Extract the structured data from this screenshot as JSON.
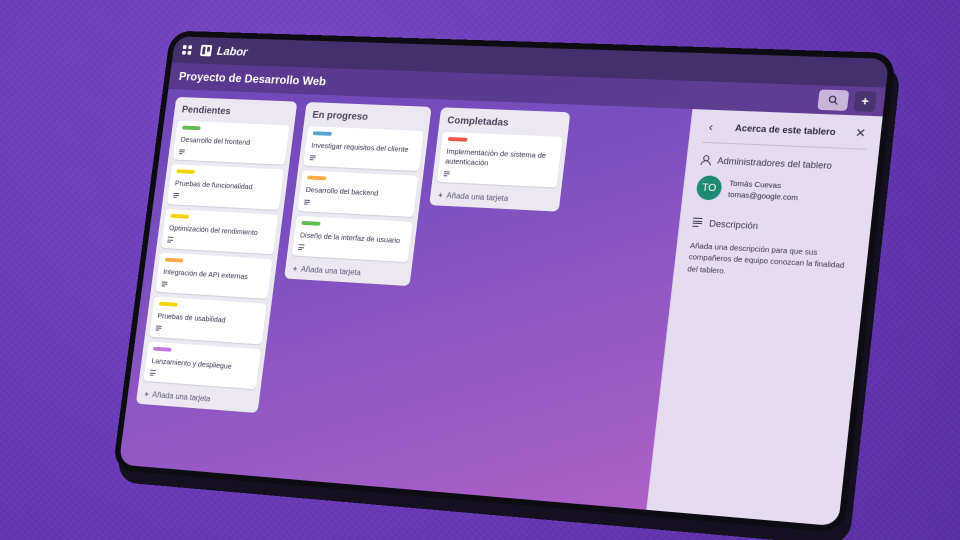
{
  "topbar": {
    "brand": "Labor"
  },
  "board": {
    "title": "Proyecto de Desarrollo Web",
    "add_label": "+"
  },
  "lists": [
    {
      "title": "Pendientes",
      "cards": [
        {
          "text": "Desarrollo del frontend",
          "label_color": "#61bd4f"
        },
        {
          "text": "Pruebas de funcionalidad",
          "label_color": "#f2d600"
        },
        {
          "text": "Optimización del rendimiento",
          "label_color": "#f2d600"
        },
        {
          "text": "Integración de API externas",
          "label_color": "#ffab4a"
        },
        {
          "text": "Pruebas de usabilidad",
          "label_color": "#f2d600"
        },
        {
          "text": "Lanzamiento y despliegue",
          "label_color": "#c377e0"
        }
      ],
      "add_label": "Añada una tarjeta"
    },
    {
      "title": "En progreso",
      "cards": [
        {
          "text": "Investigar requisitos del cliente",
          "label_color": "#5ba4cf"
        },
        {
          "text": "Desarrollo del backend",
          "label_color": "#ffab4a"
        },
        {
          "text": "Diseño de la interfaz de usuario",
          "label_color": "#61bd4f"
        }
      ],
      "add_label": "Añada una tarjeta"
    },
    {
      "title": "Completadas",
      "cards": [
        {
          "text": "Implementación de sistema de autenticación",
          "label_color": "#eb5a46"
        }
      ],
      "add_label": "Añada una tarjeta"
    }
  ],
  "panel": {
    "title": "Acerca de este tablero",
    "admins_heading": "Administradores del tablero",
    "admin": {
      "initials": "TO",
      "name": "Tomás Cuevas",
      "email": "tomas@google.com",
      "avatar_color": "#1e8a72"
    },
    "description_heading": "Descripción",
    "description_placeholder": "Añada una descripción para que sus compañeros de equipo conozcan la finalidad del tablero."
  }
}
